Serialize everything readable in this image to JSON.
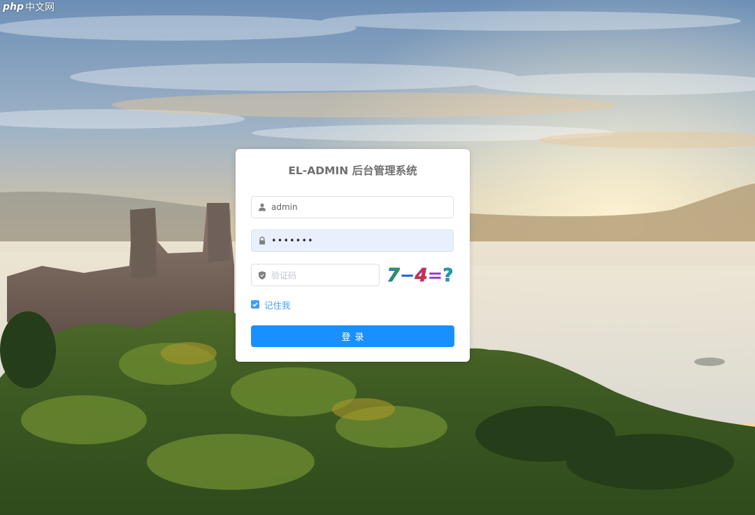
{
  "background": {
    "scene": "castle-ruin-forest-sunrise"
  },
  "watermark": {
    "logo": "php",
    "text": "中文网"
  },
  "login": {
    "title": "EL-ADMIN 后台管理系统",
    "username_value": "admin",
    "password_masked": "•••••••",
    "code_placeholder": "验证码",
    "captcha_text": "7−4=?",
    "remember_label": "记住我",
    "remember_checked": true,
    "submit_label": "登录"
  },
  "colors": {
    "primary": "#1890ff",
    "checkbox": "#409eff",
    "title": "#707070",
    "autofill_bg": "#e8f0fe",
    "captcha_digits": [
      "#2a9d3a",
      "#1e5bd6",
      "#d62e2e",
      "#8b3fc6",
      "#1aa39a"
    ]
  },
  "icons": {
    "username": "user-icon",
    "password": "lock-icon",
    "code": "shield-icon",
    "remember": "check-icon"
  }
}
